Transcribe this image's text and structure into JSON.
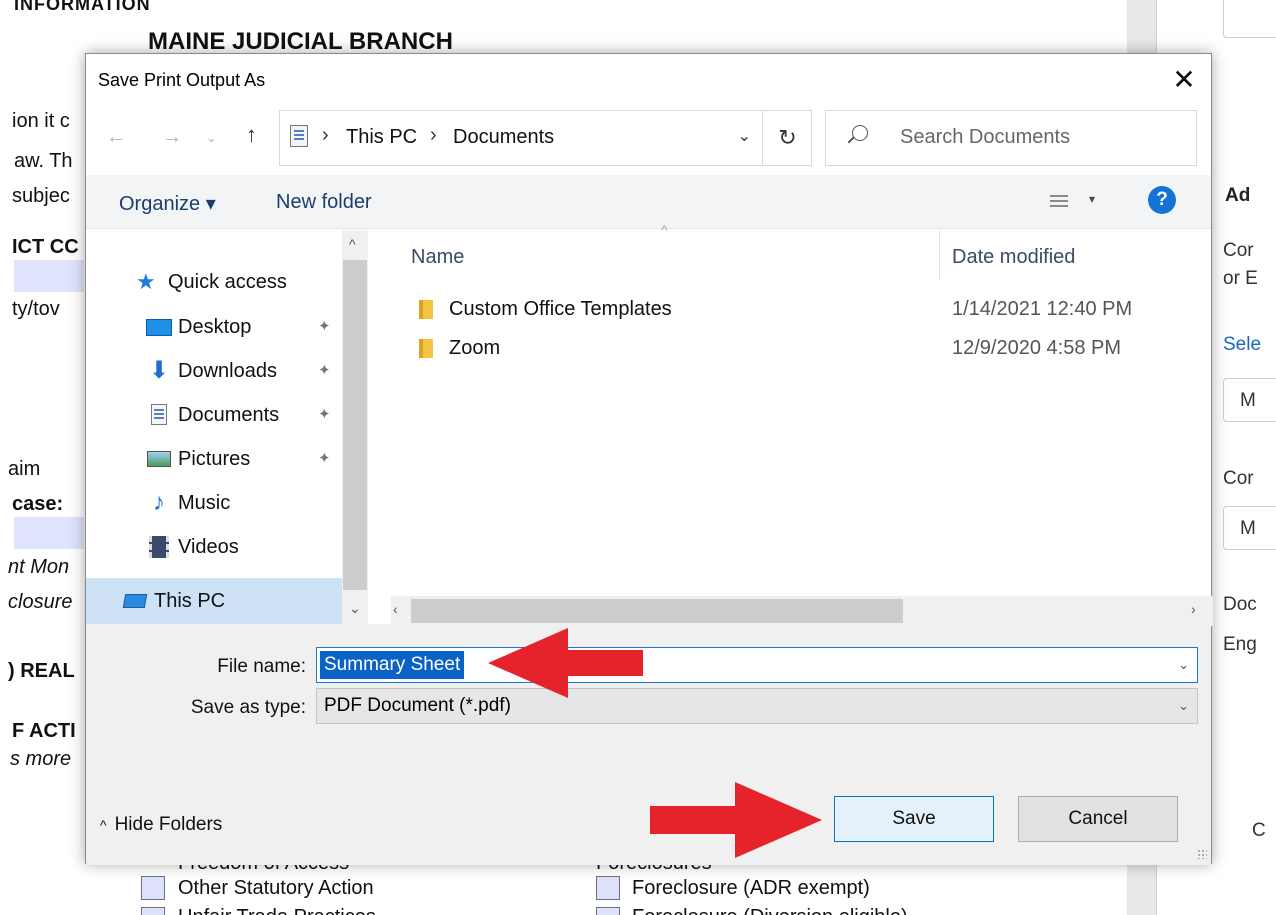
{
  "background": {
    "top_fragment": "INFORMATION",
    "title": "MAINE JUDICIAL BRANCH",
    "left_fragments": [
      "ion it c",
      "aw.  Th",
      "subjec",
      "ICT CC",
      "ty/tov",
      "aim",
      "case:",
      "nt Mon",
      "closure",
      ") REAL",
      "F ACTI",
      "s more"
    ],
    "checklist_left": "Other Statutory Action",
    "checklist_right": "Foreclosure (ADR exempt)",
    "top_partial_left": "Freedom of Access",
    "top_partial_right": "Foreclosures",
    "bottom_partial_left": "Unfair Trade Practices",
    "bottom_partial_right": "Foreclosure (Diversion eligible)"
  },
  "right_panel": {
    "items": [
      "Ad",
      "Cor",
      "or E",
      "Sele",
      "M",
      "Cor",
      "M",
      "Doc",
      "Eng",
      "C"
    ]
  },
  "dialog": {
    "title": "Save Print Output As",
    "close_label": "✕",
    "address": {
      "crumbs": [
        "This PC",
        "Documents"
      ]
    },
    "search_placeholder": "Search Documents",
    "toolbar": {
      "organize": "Organize ▾",
      "new_folder": "New folder",
      "help": "?"
    },
    "nav": {
      "quick_access": "Quick access",
      "items": [
        {
          "label": "Desktop",
          "icon": "desktop-icon",
          "pinned": true
        },
        {
          "label": "Downloads",
          "icon": "downloads-icon",
          "pinned": true
        },
        {
          "label": "Documents",
          "icon": "documents-icon",
          "pinned": true
        },
        {
          "label": "Pictures",
          "icon": "pictures-icon",
          "pinned": true
        },
        {
          "label": "Music",
          "icon": "music-icon",
          "pinned": false
        },
        {
          "label": "Videos",
          "icon": "videos-icon",
          "pinned": false
        }
      ],
      "this_pc": "This PC"
    },
    "columns": {
      "name": "Name",
      "date_modified": "Date modified"
    },
    "files": [
      {
        "name": "Custom Office Templates",
        "date": "1/14/2021 12:40 PM"
      },
      {
        "name": "Zoom",
        "date": "12/9/2020 4:58 PM"
      }
    ],
    "form": {
      "file_name_label": "File name:",
      "file_name_value": "Summary Sheet",
      "save_type_label": "Save as type:",
      "save_type_value": "PDF Document (*.pdf)"
    },
    "hide_folders": "Hide Folders",
    "save_label": "Save",
    "cancel_label": "Cancel"
  },
  "colors": {
    "accent": "#0078d7",
    "selection": "#0a62c4",
    "annotation_arrow": "#e5232b"
  }
}
